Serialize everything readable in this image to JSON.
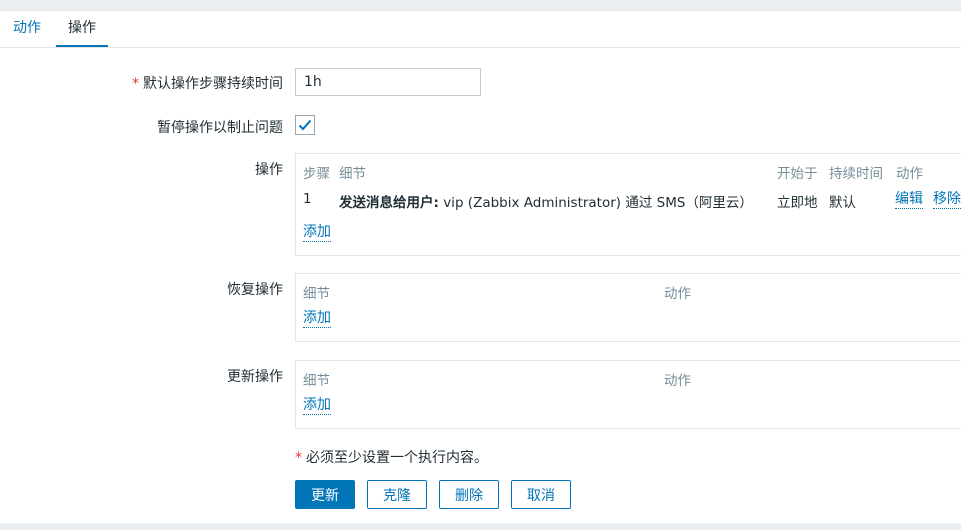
{
  "tabs": [
    {
      "label": "动作"
    },
    {
      "label": "操作"
    }
  ],
  "form": {
    "duration_label": "默认操作步骤持续时间",
    "duration_required_mark": "*",
    "duration_value": "1h",
    "pause_label": "暂停操作以制止问题",
    "pause_checked": true
  },
  "operations": {
    "label": "操作",
    "headers": {
      "step": "步骤",
      "details": "细节",
      "start_in": "开始于",
      "duration": "持续时间",
      "action": "动作"
    },
    "rows": [
      {
        "step": "1",
        "details_bold": "发送消息给用户:",
        "details_rest": " vip (Zabbix Administrator) 通过 SMS（阿里云）",
        "start_in": "立即地",
        "duration": "默认",
        "edit": "编辑",
        "remove": "移除"
      }
    ],
    "add": "添加"
  },
  "recovery_operations": {
    "label": "恢复操作",
    "headers": {
      "details": "细节",
      "action": "动作"
    },
    "add": "添加"
  },
  "update_operations": {
    "label": "更新操作",
    "headers": {
      "details": "细节",
      "action": "动作"
    },
    "add": "添加"
  },
  "note": {
    "mark": "*",
    "text": "必须至少设置一个执行内容。"
  },
  "buttons": {
    "update": "更新",
    "clone": "克隆",
    "delete": "删除",
    "cancel": "取消"
  },
  "colors": {
    "accent": "#0275b8",
    "required": "#e33734",
    "muted": "#768d99"
  }
}
